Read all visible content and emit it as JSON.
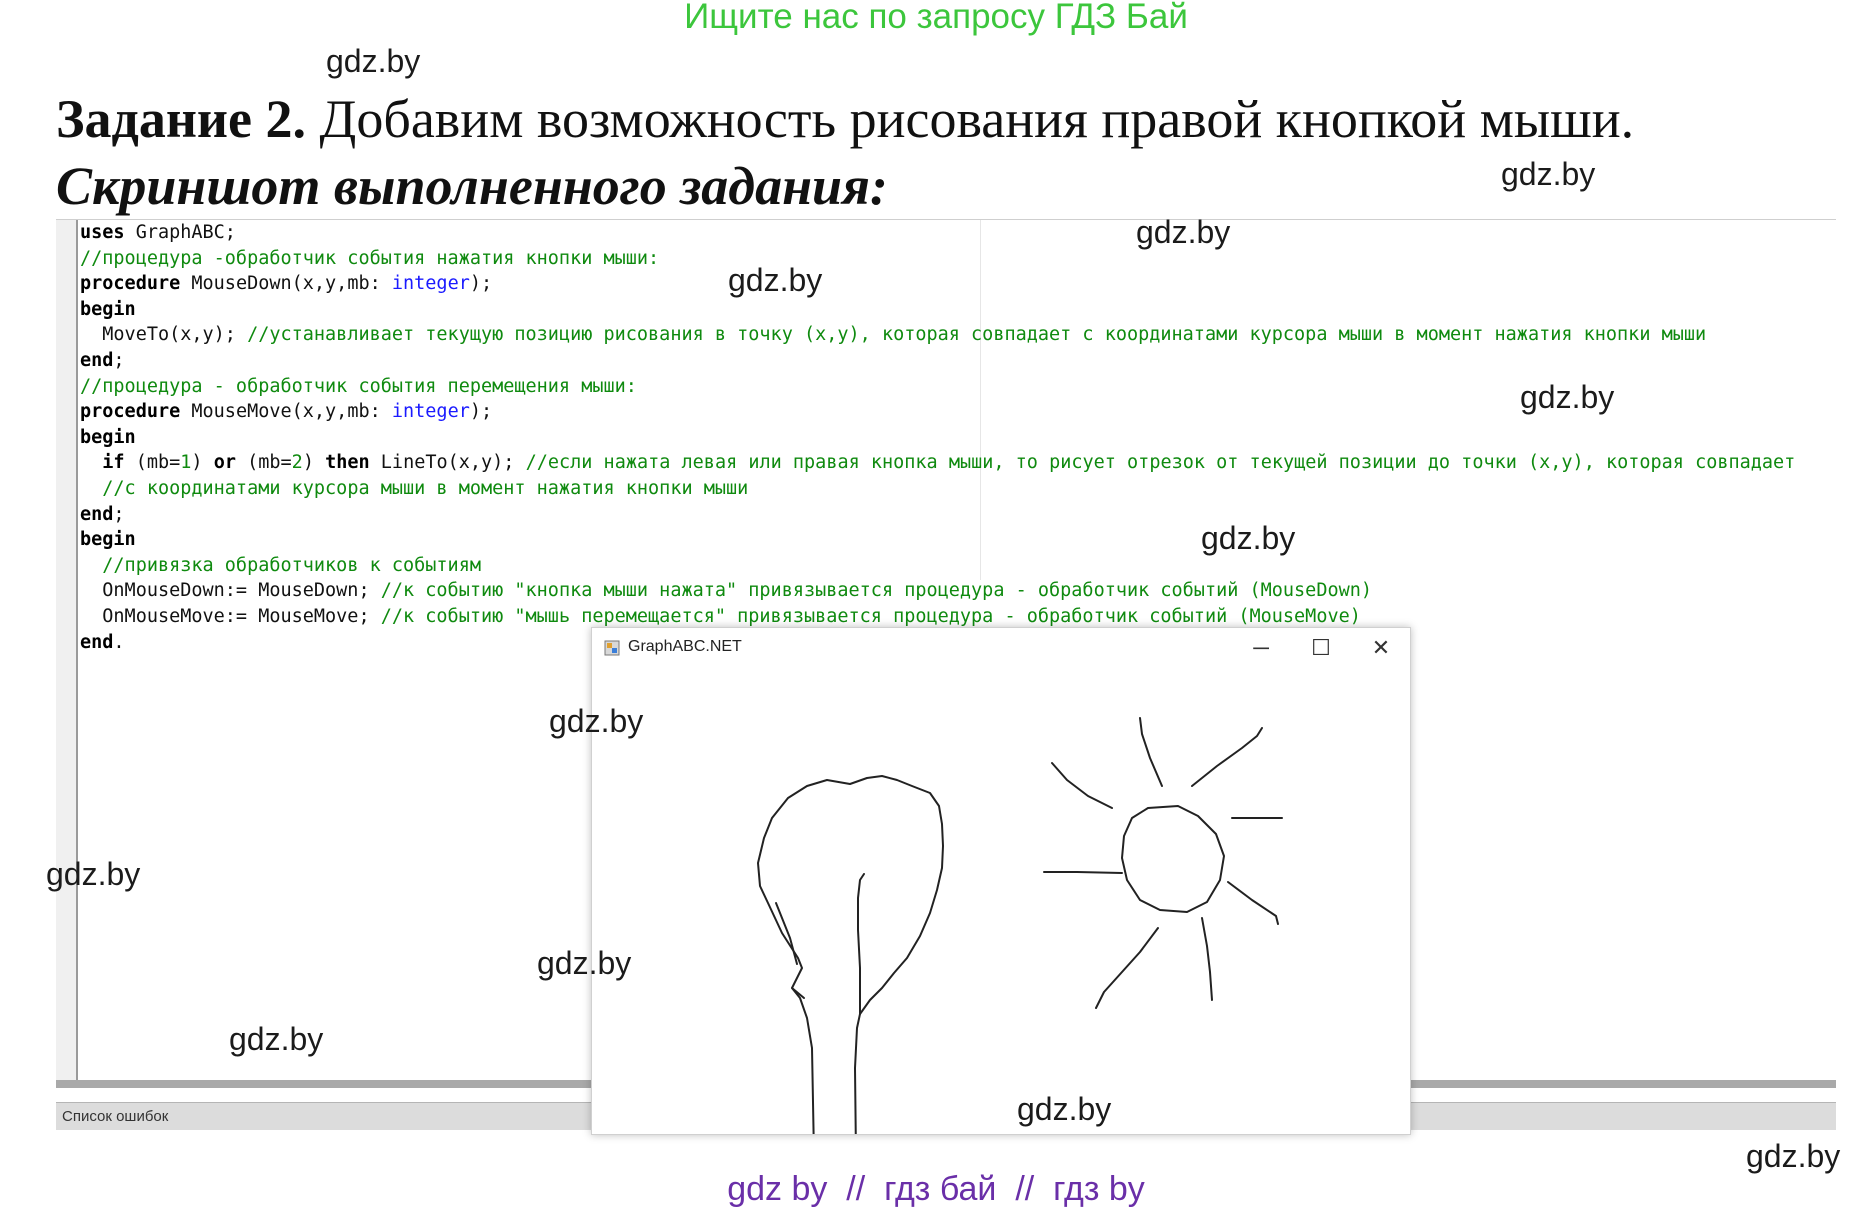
{
  "banner": "Ищите нас по запросу ГДЗ Бай",
  "watermark": "gdz.by",
  "task": {
    "label": "Задание 2.",
    "text": " Добавим возможность рисования правой кнопкой мыши."
  },
  "subtitle": "Скриншот выполненного задания:",
  "ide": {
    "code": {
      "l1_kw": "uses",
      "l1_rest": " GraphABC;",
      "l2_cm": "//процедура -обработчик события нажатия кнопки мыши:",
      "l3_kw": "procedure",
      "l3_rest": " MouseDown(x,y,mb: ",
      "l3_type": "integer",
      "l3_end": ");",
      "l4_kw": "begin",
      "l5_code": "  MoveTo(x,y); ",
      "l5_cm": "//устанавливает текущую позицию рисования в точку (x,y), которая совпадает с координатами курсора мыши в момент нажатия кнопки мыши",
      "l6_kw": "end",
      "l6_rest": ";",
      "l7_cm": "//процедура - обработчик события перемещения мыши:",
      "l8_kw": "procedure",
      "l8_rest": " MouseMove(x,y,mb: ",
      "l8_type": "integer",
      "l8_end": ");",
      "l9_kw": "begin",
      "l10_if": "if",
      "l10_a": " (mb=",
      "l10_n1": "1",
      "l10_b": ") ",
      "l10_or": "or",
      "l10_c": " (mb=",
      "l10_n2": "2",
      "l10_d": ") ",
      "l10_then": "then",
      "l10_e": " LineTo(x,y); ",
      "l10_cm": "//если нажата левая или правая кнопка мыши, то рисует отрезок от текущей позиции до точки (x,y), которая совпадает",
      "l11_cm": "//с координатами курсора мыши в момент нажатия кнопки мыши",
      "l12_kw": "end",
      "l12_rest": ";",
      "l13_kw": "begin",
      "l14_cm": "//привязка обработчиков к событиям",
      "l15_code": "  OnMouseDown:= MouseDown; ",
      "l15_cm": "//к событию \"кнопка мыши нажата\" привязывается процедура - обработчик событий (MouseDown)",
      "l16_code": "  OnMouseMove:= MouseMove; ",
      "l16_cm": "//к событию \"мышь перемещается\" привязывается процедура - обработчик событий (MouseMove)",
      "l17_kw": "end",
      "l17_rest": "."
    },
    "errors_tab": "Список ошибок"
  },
  "graph_window": {
    "title": "GraphABC.NET",
    "minimize": "─",
    "maximize": "☐",
    "close": "✕",
    "drawing": "tree and sun sketch"
  },
  "footer": "gdz by  //  гдз бай  //  гдз by",
  "colors": {
    "banner": "#3cc63c",
    "comment": "#0f8a0f",
    "type": "#1a1aff",
    "footer": "#6a2fa8"
  }
}
